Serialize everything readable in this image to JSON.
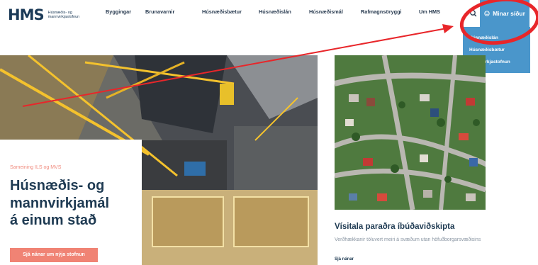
{
  "header": {
    "logo_mark": "HMS",
    "logo_text_line1": "Húsnæðis- og",
    "logo_text_line2": "mannvirkjastofnun",
    "nav": [
      "Byggingar",
      "Brunavarnir",
      "Húsnæðisbætur",
      "Húsnæðislán",
      "Húsnæðismál",
      "Rafmagnsöryggi",
      "Um HMS"
    ],
    "minar_label": "Minar síður"
  },
  "dropdown": {
    "items": [
      "Húsnæðislán",
      "Húsnæðisbætur",
      "Mannvirkjastofnun"
    ]
  },
  "hero": {
    "eyebrow": "Sameining ILS og MVS",
    "title_lines": [
      "Húsnæðis- og",
      "mannvirkjamál",
      "á einum stað"
    ],
    "cta_label": "Sjá nánar um nýja stofnun"
  },
  "side": {
    "title": "Vísitala paraðra íbúðaviðskipta",
    "description": "Verðhækkanir töluvert meiri á svæðum utan höfuðborgarsvæðisins",
    "link_label": "Sjá nánar"
  },
  "colors": {
    "accent_blue": "#4a96cb",
    "coral": "#f08374",
    "navy": "#1f3b53",
    "annotation_red": "#e8262a"
  },
  "icons": [
    "search-icon",
    "user-circle-icon"
  ]
}
